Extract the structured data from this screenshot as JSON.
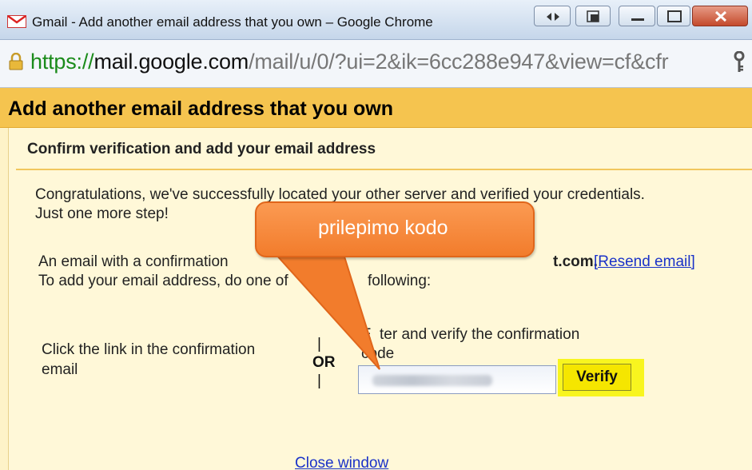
{
  "window": {
    "title": "Gmail - Add another email address that you own – Google Chrome"
  },
  "address_bar": {
    "scheme": "https://",
    "host": "mail.google.com",
    "path": "/mail/u/0/?ui=2&ik=6cc288e947&view=cf&cfr"
  },
  "page": {
    "header": "Add another email address that you own",
    "subtitle": "Confirm verification and add your email address",
    "congrats_line1": "Congratulations, we've successfully located your other server and verified your credentials.",
    "congrats_line2": "Just one more step!",
    "email_sent_prefix": "An email with a confirmation",
    "email_sent_suffix": "t.com.",
    "resend_link": "[Resend email]",
    "to_add_prefix": "To add your email address, do one of",
    "to_add_suffix": "following:",
    "option_link_line1": "Click the link in the confirmation",
    "option_link_line2": "email",
    "or_label": "OR",
    "option_code_line1_prefix": "E",
    "option_code_line1_suffix": "ter and verify the confirmation",
    "option_code_line2": "code",
    "verify_button": "Verify",
    "close_window": "Close window"
  },
  "callout": {
    "text": "prilepimo kodo",
    "color": "#f58535"
  },
  "colors": {
    "header_bg": "#f5c44f",
    "panel_bg": "#fff8d8",
    "highlight": "#f8f51f",
    "link": "#1a32c8"
  }
}
